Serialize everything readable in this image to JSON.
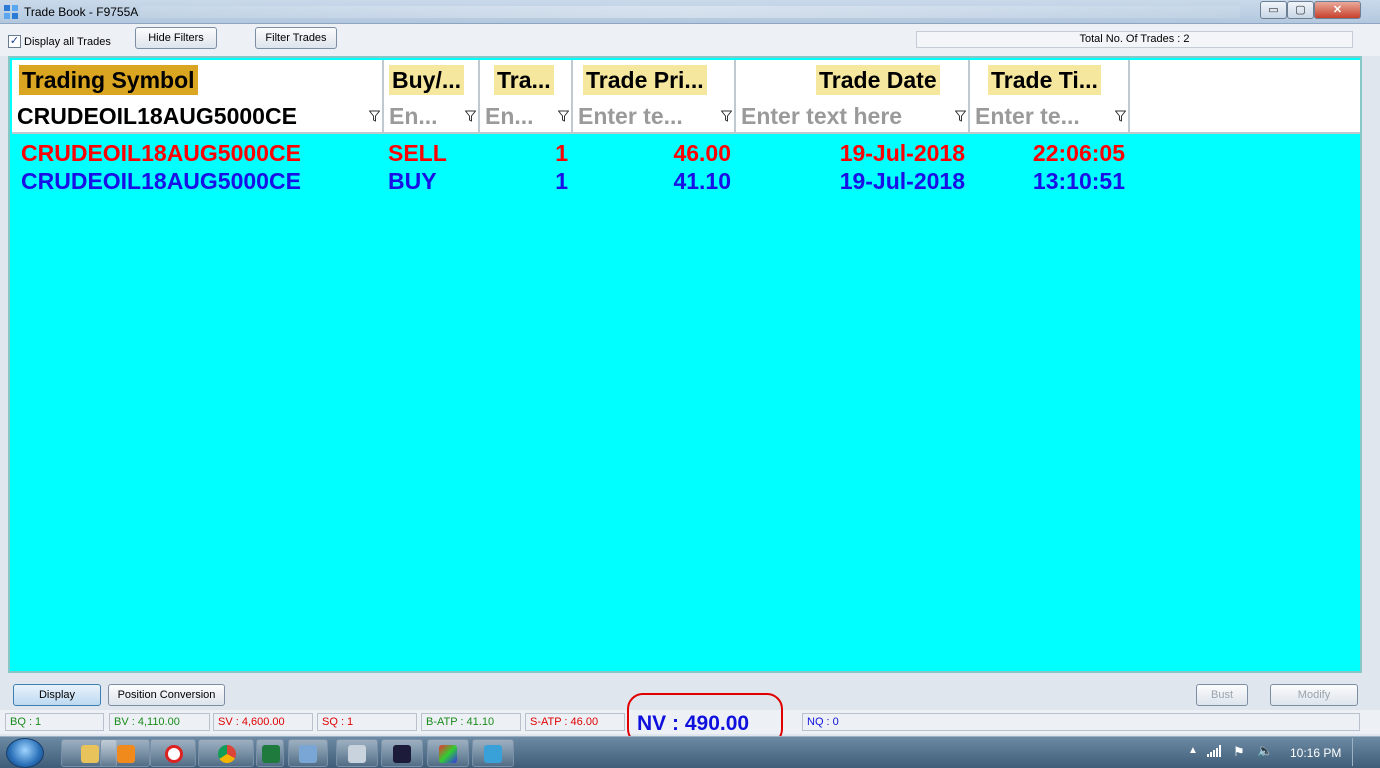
{
  "window": {
    "title": "Trade Book - F9755A",
    "controls": {
      "minimize": "▭",
      "maximize": "▢",
      "close": "✕"
    }
  },
  "toolbar": {
    "display_all_label": "Display all Trades",
    "display_all_checked": true,
    "hide_filters_label": "Hide Filters",
    "filter_trades_label": "Filter Trades",
    "total_trades_text": "Total No. Of Trades : 2"
  },
  "grid": {
    "columns": [
      "Trading Symbol",
      "Buy/...",
      "Tra...",
      "Trade Pri...",
      "Trade Date",
      "Trade Ti..."
    ],
    "filters": [
      "CRUDEOIL18AUG5000CE",
      "En...",
      "En...",
      "Enter te...",
      "Enter text here",
      "Enter te..."
    ],
    "rows": [
      {
        "symbol": "CRUDEOIL18AUG5000CE",
        "side": "SELL",
        "qty": "1",
        "price": "46.00",
        "date": "19-Jul-2018",
        "time": "22:06:05"
      },
      {
        "symbol": "CRUDEOIL18AUG5000CE",
        "side": "BUY",
        "qty": "1",
        "price": "41.10",
        "date": "19-Jul-2018",
        "time": "13:10:51"
      }
    ],
    "colors": {
      "background": "#00ffff",
      "sell": "#ff0000",
      "buy": "#1a10e6",
      "header_highlight": "#f5e79d"
    }
  },
  "actions": {
    "display_label": "Display",
    "position_conversion_label": "Position Conversion",
    "bust_label": "Bust",
    "modify_label": "Modify"
  },
  "status": {
    "bq": "BQ : 1",
    "bv": "BV : 4,110.00",
    "sv": "SV : 4,600.00",
    "sq": "SQ : 1",
    "batp": "B-ATP : 41.10",
    "satp": "S-ATP : 46.00",
    "nv": "NV : 490.00",
    "nq": "NQ : 0"
  },
  "taskbar": {
    "apps": [
      "file-explorer",
      "media-player",
      "lifebuoy-app",
      "chrome",
      "excel",
      "window-app",
      "calculator",
      "chart-app",
      "prism-app",
      "network-app"
    ],
    "clock": "10:16 PM"
  }
}
